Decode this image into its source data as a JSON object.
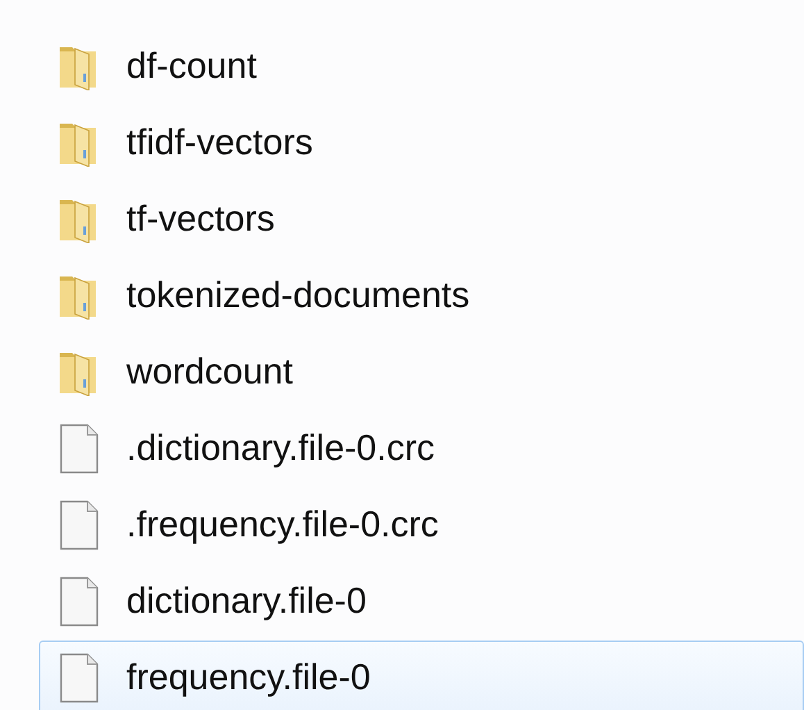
{
  "files": [
    {
      "name": "df-count",
      "kind": "folder",
      "selected": false
    },
    {
      "name": "tfidf-vectors",
      "kind": "folder",
      "selected": false
    },
    {
      "name": "tf-vectors",
      "kind": "folder",
      "selected": false
    },
    {
      "name": "tokenized-documents",
      "kind": "folder",
      "selected": false
    },
    {
      "name": "wordcount",
      "kind": "folder",
      "selected": false
    },
    {
      "name": ".dictionary.file-0.crc",
      "kind": "file",
      "selected": false
    },
    {
      "name": ".frequency.file-0.crc",
      "kind": "file",
      "selected": false
    },
    {
      "name": "dictionary.file-0",
      "kind": "file",
      "selected": false
    },
    {
      "name": "frequency.file-0",
      "kind": "file",
      "selected": true
    }
  ]
}
